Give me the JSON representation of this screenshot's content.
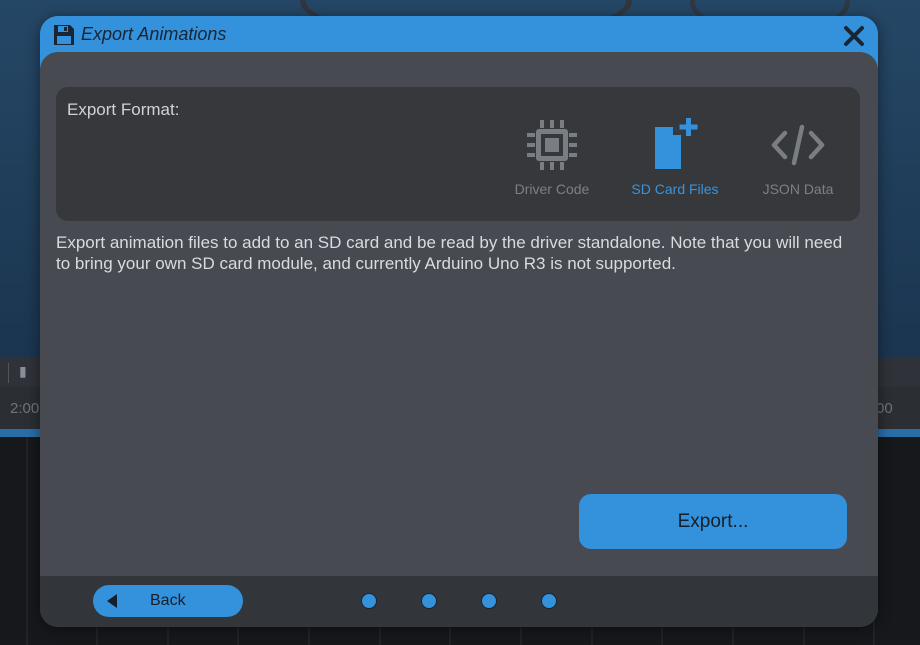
{
  "dialog": {
    "title": "Export Animations",
    "title_icon": "save-icon",
    "close_icon": "close-icon",
    "accent_color": "#3491dc"
  },
  "format": {
    "label": "Export Format:",
    "options": [
      {
        "label": "Driver Code",
        "icon": "chip-icon",
        "selected": false
      },
      {
        "label": "SD Card Files",
        "icon": "file-add-icon",
        "selected": true
      },
      {
        "label": "JSON Data",
        "icon": "code-icon",
        "selected": false
      }
    ]
  },
  "description": "Export animation files to add to an SD card and be read by the driver standalone. Note that you will need to bring your own SD card module, and currently Arduino Uno R3 is not supported.",
  "export_button": "Export...",
  "footer": {
    "back_label": "Back",
    "steps": 4
  },
  "background": {
    "time_left": "2:00",
    "time_right": "00"
  }
}
